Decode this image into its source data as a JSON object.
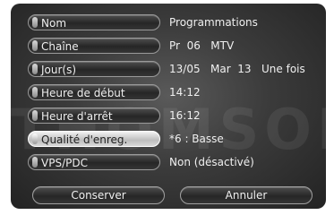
{
  "menu": {
    "rows": [
      {
        "label": "Nom",
        "value": "Programmations"
      },
      {
        "label": "Chaîne",
        "value": "Pr  06   MTV"
      },
      {
        "label": "Jour(s)",
        "value": "13/05   Mar  13   Une fois"
      },
      {
        "label": "Heure de début",
        "value": "14:12"
      },
      {
        "label": "Heure d'arrêt",
        "value": "16:12"
      },
      {
        "label": "Qualité d'enreg.",
        "value": "*6 : Basse"
      },
      {
        "label": "VPS/PDC",
        "value": "Non (désactivé)"
      }
    ]
  },
  "buttons": {
    "save": "Conserver",
    "cancel": "Annuler"
  },
  "watermark": "THOMSON",
  "colors": {
    "background": "#3b3b3b",
    "text": "#f0f0f0",
    "active_field": "#d8d8d8"
  }
}
